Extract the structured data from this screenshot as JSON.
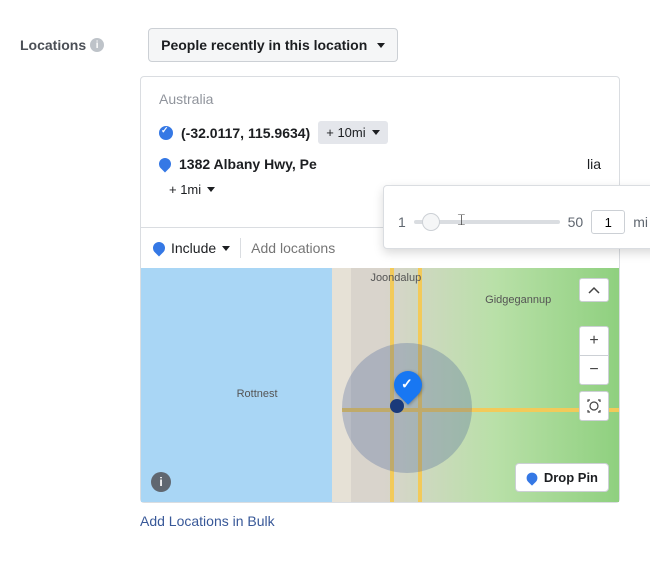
{
  "section_label": "Locations",
  "audience_dropdown": "People recently in this location",
  "country_group": "Australia",
  "locations": [
    {
      "text": "(-32.0117, 115.9634)",
      "radius_chip": "+ 10mi",
      "icon": "pin-check"
    },
    {
      "text": "1382 Albany Hwy, Pe",
      "suffix": "lia",
      "radius_chip": "+ 1mi",
      "icon": "pin-blue"
    }
  ],
  "radius_popover": {
    "min": "1",
    "max": "50",
    "value": "1",
    "unit": "mi"
  },
  "include_bar": {
    "mode": "Include",
    "placeholder": "Add locations"
  },
  "map": {
    "labels": {
      "joondalup": "Joondalup",
      "gidgegannup": "Gidgegannup",
      "rottnest": "Rottnest"
    },
    "drop_pin": "Drop Pin"
  },
  "bulk_link": "Add Locations in Bulk"
}
